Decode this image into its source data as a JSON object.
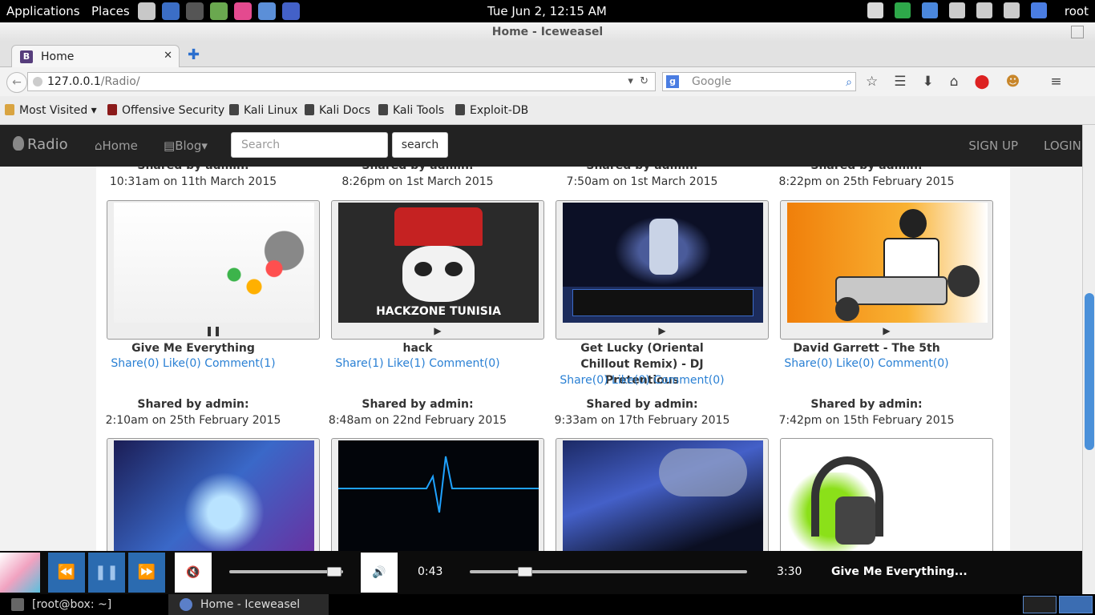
{
  "desktop": {
    "applications": "Applications",
    "places": "Places",
    "clock": "Tue Jun  2, 12:15 AM",
    "user": "root",
    "launcher_colors": [
      "#c8c8c8",
      "#3b6ec6",
      "#555555",
      "#6aa84f",
      "#e44a8f",
      "#5b8fd8",
      "#4361c8"
    ],
    "tray_icons": [
      "notification-icon",
      "green-dot-icon",
      "chrome-icon",
      "volume-icon",
      "clipboard-icon",
      "bluetooth-icon",
      "signal-icon"
    ]
  },
  "browser": {
    "window_title": "Home - Iceweasel",
    "tab_label": "Home",
    "tab_favicon": "B",
    "url_host": "127.0.0.1",
    "url_path": "/Radio/",
    "search_placeholder": "Google",
    "bookmarks": [
      "Most Visited",
      "Offensive Security",
      "Kali Linux",
      "Kali Docs",
      "Kali Tools",
      "Exploit-DB"
    ]
  },
  "site": {
    "brand": "Radio",
    "nav_home": "Home",
    "nav_blog": "Blog",
    "search_placeholder": "Search",
    "search_button": "search",
    "signup": "SIGN UP",
    "login": "LOGIN",
    "top_row_partial": [
      {
        "shared": "Shared by admin:",
        "when": "10:31am on 11th March 2015"
      },
      {
        "shared": "Shared by admin:",
        "when": "8:26pm on 1st March 2015"
      },
      {
        "shared": "Shared by admin:",
        "when": "7:50am on 1st March 2015"
      },
      {
        "shared": "Shared by admin:",
        "when": "8:22pm on 25th February 2015"
      }
    ],
    "row1": [
      {
        "title": "Give Me Everything",
        "share": "Share(0)",
        "like": "Like(0)",
        "comment": "Comment(1)",
        "control": "❚❚",
        "img": "colorful-speaker"
      },
      {
        "title": "hack",
        "share": "Share(1)",
        "like": "Like(1)",
        "comment": "Comment(0)",
        "control": "▶",
        "img": "hackzone-skull",
        "img_text": "HACKZONE TUNISIA"
      },
      {
        "title": "Get Lucky (Oriental Chillout Remix) - DJ Pretentious",
        "share": "Share(0)",
        "like": "Like(0)",
        "comment": "Comment(0)",
        "control": "▶",
        "img": "dj-night"
      },
      {
        "title": "David Garrett - The 5th",
        "share": "Share(0)",
        "like": "Like(0)",
        "comment": "Comment(0)",
        "control": "▶",
        "img": "orange-dj"
      }
    ],
    "row2": [
      {
        "shared": "Shared by admin:",
        "when": "2:10am on 25th February 2015"
      },
      {
        "shared": "Shared by admin:",
        "when": "8:48am on 22nd February 2015"
      },
      {
        "shared": "Shared by admin:",
        "when": "9:33am on 17th February 2015"
      },
      {
        "shared": "Shared by admin:",
        "when": "7:42pm on 15th February 2015"
      }
    ]
  },
  "player": {
    "elapsed": "0:43",
    "duration": "3:30",
    "progress_fraction": 0.2,
    "volume_fraction": 0.92,
    "now_playing": "Give Me Everything..."
  },
  "taskbar": {
    "terminal": "[root@box: ~]",
    "browser": "Home - Iceweasel"
  }
}
